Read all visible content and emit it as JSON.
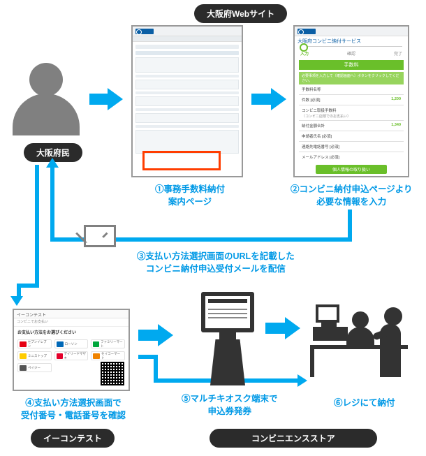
{
  "headers": {
    "top": "大阪府Webサイト",
    "bottom_left": "イーコンテスト",
    "bottom_right": "コンビニエンスストア"
  },
  "actors": {
    "citizen": "大阪府民"
  },
  "captions": {
    "step1": "①事務手数料納付\n案内ページ",
    "step2": "②コンビニ納付申込ページより\n必要な情報を入力",
    "step3": "③支払い方法選択画面のURLを記載した\nコンビニ納付申込受付メールを配信",
    "step4": "④支払い方法選択画面で\n受付番号・電話番号を確認",
    "step5": "⑤マルチキオスク端末で\n申込券発券",
    "step6": "⑥レジにて納付"
  },
  "thumb2": {
    "service_title": "大阪府コンビニ納付サービス",
    "steps": [
      "入力",
      "確認",
      "完了"
    ],
    "section": "手数料",
    "note": "必要事項を入力して〔確認画面へ〕ボタンをクリックしてください。",
    "rows": [
      {
        "label": "手数料名称",
        "value": ""
      },
      {
        "label": "件数 [必須]",
        "value": "1,200"
      },
      {
        "label": "コンビニ取扱手数料",
        "value": ""
      },
      {
        "label": "納付金額合計",
        "value": "1,340"
      },
      {
        "label": "申請者氏名 [必須]",
        "value": ""
      },
      {
        "label": "連絡先電話番号 [必須]",
        "value": ""
      },
      {
        "label": "メールアドレス [必須]",
        "value": ""
      }
    ],
    "button": "個人情報の取り扱い"
  },
  "thumb3": {
    "title": "イーコンテスト",
    "lead": "お支払い方法をお選びください",
    "options": [
      "セブンイレブン",
      "ローソン",
      "ファミリーマート",
      "ミニストップ",
      "デイリーヤマザキ",
      "セイコーマート",
      "ペイジー",
      ""
    ]
  },
  "icons": {
    "envelope": "envelope-icon",
    "person": "person-icon",
    "kiosk": "kiosk-icon",
    "register": "register-icon"
  }
}
